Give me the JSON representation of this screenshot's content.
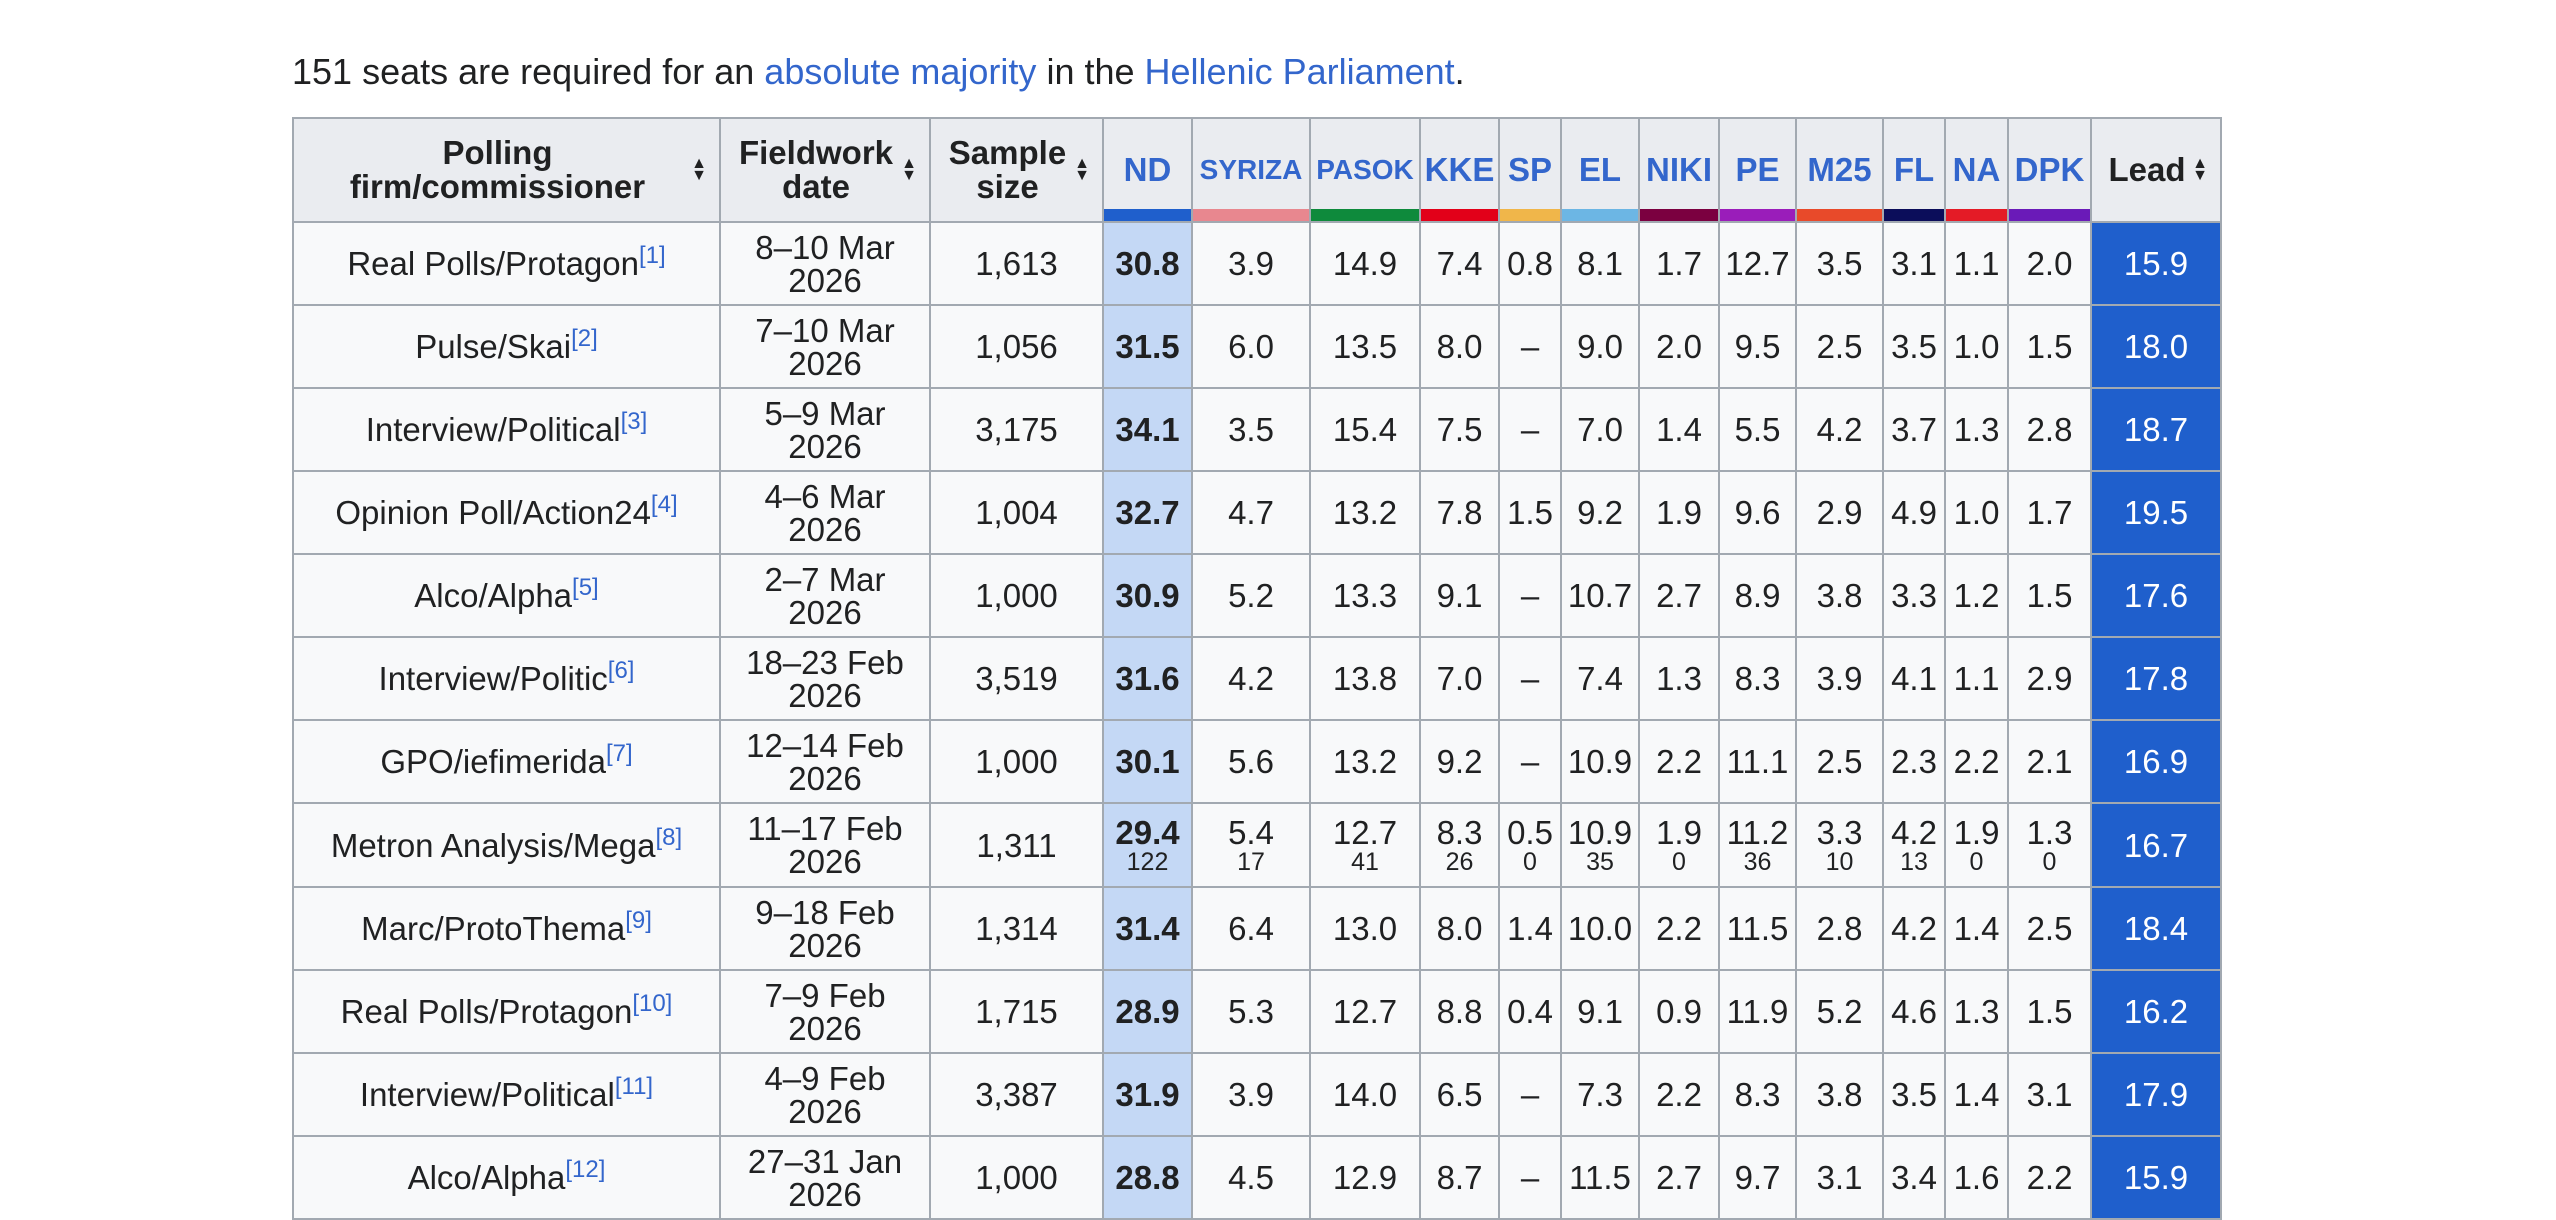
{
  "intro": {
    "prefix": "151 seats are required for an ",
    "link1": "absolute majority",
    "middle": " in the ",
    "link2": "Hellenic Parliament",
    "suffix": "."
  },
  "colors": {
    "link": "#3366cc",
    "nd_cell": "#c4d8f5",
    "lead_cell": "#1f5fcc",
    "party_bars": {
      "ND": "#1f5fcc",
      "SYRIZA": "#e8878f",
      "PASOK": "#0e8a3c",
      "KKE": "#e20019",
      "SP": "#f0b64a",
      "EL": "#6cb6e4",
      "NIKI": "#7b0040",
      "PE": "#9a1dba",
      "M25": "#e84a2a",
      "FL": "#0b0d5a",
      "NA": "#e41b26",
      "DPK": "#6a1ab8"
    }
  },
  "table": {
    "headers": {
      "firm": "Polling firm/commissioner",
      "date": "Fieldwork date",
      "sample": "Sample size",
      "lead": "Lead"
    },
    "parties": [
      "ND",
      "SYRIZA",
      "PASOK",
      "KKE",
      "SP",
      "EL",
      "NIKI",
      "PE",
      "M25",
      "FL",
      "NA",
      "DPK"
    ],
    "rows": [
      {
        "firm": "Real Polls/Protagon",
        "ref": "[1]",
        "date": "8–10 Mar 2026",
        "sample": "1,613",
        "values": [
          "30.8",
          "3.9",
          "14.9",
          "7.4",
          "0.8",
          "8.1",
          "1.7",
          "12.7",
          "3.5",
          "3.1",
          "1.1",
          "2.0"
        ],
        "lead": "15.9"
      },
      {
        "firm": "Pulse/Skai",
        "ref": "[2]",
        "date": "7–10 Mar 2026",
        "sample": "1,056",
        "values": [
          "31.5",
          "6.0",
          "13.5",
          "8.0",
          "–",
          "9.0",
          "2.0",
          "9.5",
          "2.5",
          "3.5",
          "1.0",
          "1.5"
        ],
        "lead": "18.0"
      },
      {
        "firm": "Interview/Political",
        "ref": "[3]",
        "date": "5–9 Mar 2026",
        "sample": "3,175",
        "values": [
          "34.1",
          "3.5",
          "15.4",
          "7.5",
          "–",
          "7.0",
          "1.4",
          "5.5",
          "4.2",
          "3.7",
          "1.3",
          "2.8"
        ],
        "lead": "18.7"
      },
      {
        "firm": "Opinion Poll/Action24",
        "ref": "[4]",
        "date": "4–6 Mar 2026",
        "sample": "1,004",
        "values": [
          "32.7",
          "4.7",
          "13.2",
          "7.8",
          "1.5",
          "9.2",
          "1.9",
          "9.6",
          "2.9",
          "4.9",
          "1.0",
          "1.7"
        ],
        "lead": "19.5"
      },
      {
        "firm": "Alco/Alpha",
        "ref": "[5]",
        "date": "2–7 Mar 2026",
        "sample": "1,000",
        "values": [
          "30.9",
          "5.2",
          "13.3",
          "9.1",
          "–",
          "10.7",
          "2.7",
          "8.9",
          "3.8",
          "3.3",
          "1.2",
          "1.5"
        ],
        "lead": "17.6"
      },
      {
        "firm": "Interview/Politic",
        "ref": "[6]",
        "date": "18–23 Feb 2026",
        "sample": "3,519",
        "values": [
          "31.6",
          "4.2",
          "13.8",
          "7.0",
          "–",
          "7.4",
          "1.3",
          "8.3",
          "3.9",
          "4.1",
          "1.1",
          "2.9"
        ],
        "lead": "17.8"
      },
      {
        "firm": "GPO/iefimerida",
        "ref": "[7]",
        "date": "12–14 Feb 2026",
        "sample": "1,000",
        "values": [
          "30.1",
          "5.6",
          "13.2",
          "9.2",
          "–",
          "10.9",
          "2.2",
          "11.1",
          "2.5",
          "2.3",
          "2.2",
          "2.1"
        ],
        "lead": "16.9"
      },
      {
        "firm": "Metron Analysis/Mega",
        "ref": "[8]",
        "date": "11–17 Feb 2026",
        "sample": "1,311",
        "values": [
          "29.4",
          "5.4",
          "12.7",
          "8.3",
          "0.5",
          "10.9",
          "1.9",
          "11.2",
          "3.3",
          "4.2",
          "1.9",
          "1.3"
        ],
        "seats": [
          "122",
          "17",
          "41",
          "26",
          "0",
          "35",
          "0",
          "36",
          "10",
          "13",
          "0",
          "0"
        ],
        "lead": "16.7"
      },
      {
        "firm": "Marc/ProtoThema",
        "ref": "[9]",
        "date": "9–18 Feb 2026",
        "sample": "1,314",
        "values": [
          "31.4",
          "6.4",
          "13.0",
          "8.0",
          "1.4",
          "10.0",
          "2.2",
          "11.5",
          "2.8",
          "4.2",
          "1.4",
          "2.5"
        ],
        "lead": "18.4"
      },
      {
        "firm": "Real Polls/Protagon",
        "ref": "[10]",
        "date": "7–9 Feb 2026",
        "sample": "1,715",
        "values": [
          "28.9",
          "5.3",
          "12.7",
          "8.8",
          "0.4",
          "9.1",
          "0.9",
          "11.9",
          "5.2",
          "4.6",
          "1.3",
          "1.5"
        ],
        "lead": "16.2"
      },
      {
        "firm": "Interview/Political",
        "ref": "[11]",
        "date": "4–9 Feb 2026",
        "sample": "3,387",
        "values": [
          "31.9",
          "3.9",
          "14.0",
          "6.5",
          "–",
          "7.3",
          "2.2",
          "8.3",
          "3.8",
          "3.5",
          "1.4",
          "3.1"
        ],
        "lead": "17.9"
      },
      {
        "firm": "Alco/Alpha",
        "ref": "[12]",
        "date": "27–31 Jan 2026",
        "sample": "1,000",
        "values": [
          "28.8",
          "4.5",
          "12.9",
          "8.7",
          "–",
          "11.5",
          "2.7",
          "9.7",
          "3.1",
          "3.4",
          "1.6",
          "2.2"
        ],
        "lead": "15.9"
      }
    ]
  }
}
